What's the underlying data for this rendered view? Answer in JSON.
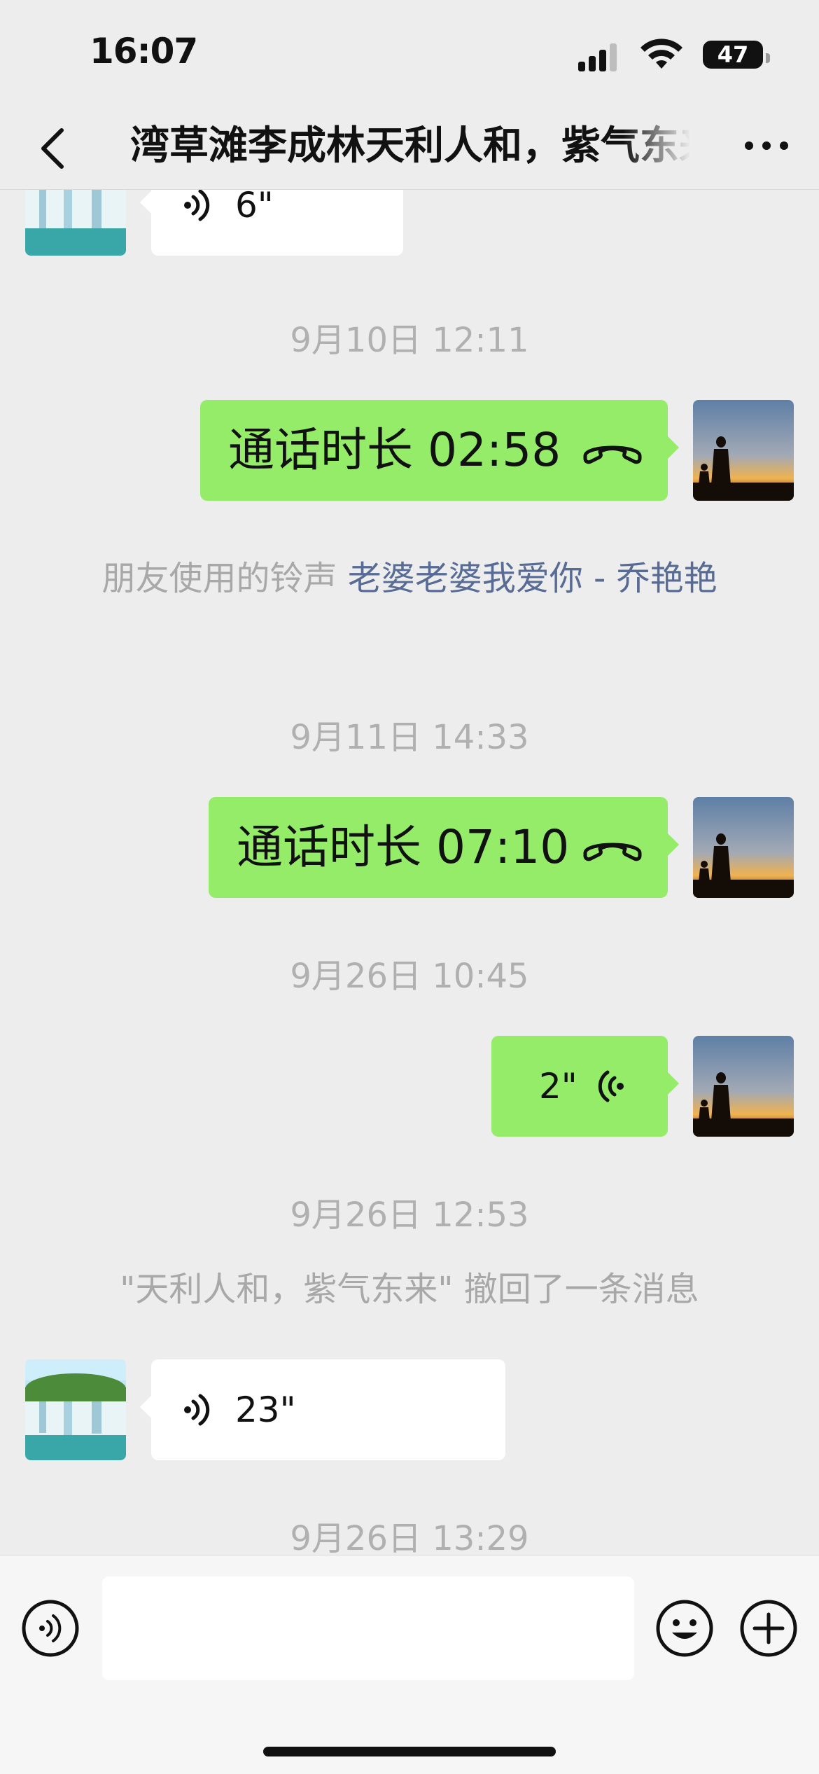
{
  "status_bar": {
    "time": "16:07",
    "battery": "47"
  },
  "nav": {
    "title": "湾草滩李成林天利人和，紫气东来"
  },
  "messages": {
    "m1": {
      "duration": "6\""
    },
    "ts1": "9月10日 12:11",
    "m2": {
      "text": "通话时长 02:58"
    },
    "notice1": {
      "prefix": "朋友使用的铃声 ",
      "link": "老婆老婆我爱你 - 乔艳艳"
    },
    "ts2": "9月11日 14:33",
    "m3": {
      "text": "通话时长 07:10"
    },
    "ts3": "9月26日 10:45",
    "m4": {
      "duration": "2\""
    },
    "ts4": "9月26日 12:53",
    "notice2": "\"天利人和，紫气东来\" 撤回了一条消息",
    "m5": {
      "duration": "23\""
    },
    "ts5": "9月26日 13:29"
  },
  "colors": {
    "sent_bubble": "#95ec69",
    "received_bubble": "#ffffff",
    "link": "#576b95",
    "background": "#ededed"
  },
  "icons": [
    "back-icon",
    "more-icon",
    "voice-icon",
    "phone-hangup-icon",
    "voice-input-icon",
    "emoji-icon",
    "add-icon"
  ]
}
